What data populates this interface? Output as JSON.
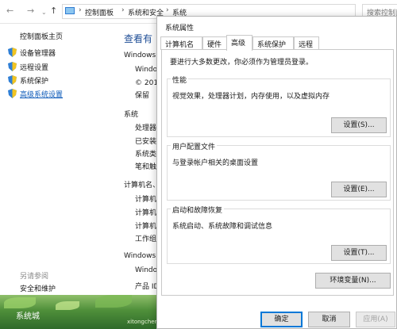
{
  "control_panel": {
    "address_bar": {
      "crumbs": [
        "控制面板",
        "系统和安全",
        "系统"
      ],
      "search_placeholder": "搜索控制面"
    },
    "left_pane": {
      "home_link": "控制面板主页",
      "links": [
        {
          "label": "设备管理器",
          "icon": "uac-shield-icon"
        },
        {
          "label": "远程设置",
          "icon": "uac-shield-icon"
        },
        {
          "label": "系统保护",
          "icon": "uac-shield-icon"
        },
        {
          "label": "高级系统设置",
          "icon": "uac-shield-icon",
          "active": true
        }
      ],
      "see_also": "另请参阅",
      "security_link": "安全和维护"
    },
    "main_pane": {
      "heading": "查看有",
      "lines": [
        "Windows",
        "Windo",
        "© 201",
        "保留",
        "系统",
        "处理器",
        "已安装",
        "系统类",
        "笔和触",
        "计算机名、",
        "计算机",
        "计算机",
        "计算机",
        "工作组",
        "Windows",
        "Windo",
        "产品 ID"
      ]
    },
    "desktop_watermark": "系统城",
    "desktop_watermark2": "xitongcheng.com"
  },
  "dialog": {
    "title": "系统属性",
    "tabs": [
      "计算机名",
      "硬件",
      "高级",
      "系统保护",
      "远程"
    ],
    "selected_tab": "高级",
    "admin_note": "要进行大多数更改，你必须作为管理员登录。",
    "performance": {
      "title": "性能",
      "description": "视觉效果，处理器计划，内存使用，以及虚拟内存",
      "button": "设置(S)..."
    },
    "user_profiles": {
      "title": "用户配置文件",
      "description": "与登录帐户相关的桌面设置",
      "button": "设置(E)..."
    },
    "startup_recovery": {
      "title": "启动和故障恢复",
      "description": "系统启动、系统故障和调试信息",
      "button": "设置(T)..."
    },
    "env_button": "环境变量(N)...",
    "ok_button": "确定",
    "cancel_button": "取消",
    "apply_button": "应用(A)"
  },
  "colors": {
    "link_active": "#0a58b8",
    "heading_blue": "#1f4e96",
    "default_button_border": "#0078d7"
  }
}
